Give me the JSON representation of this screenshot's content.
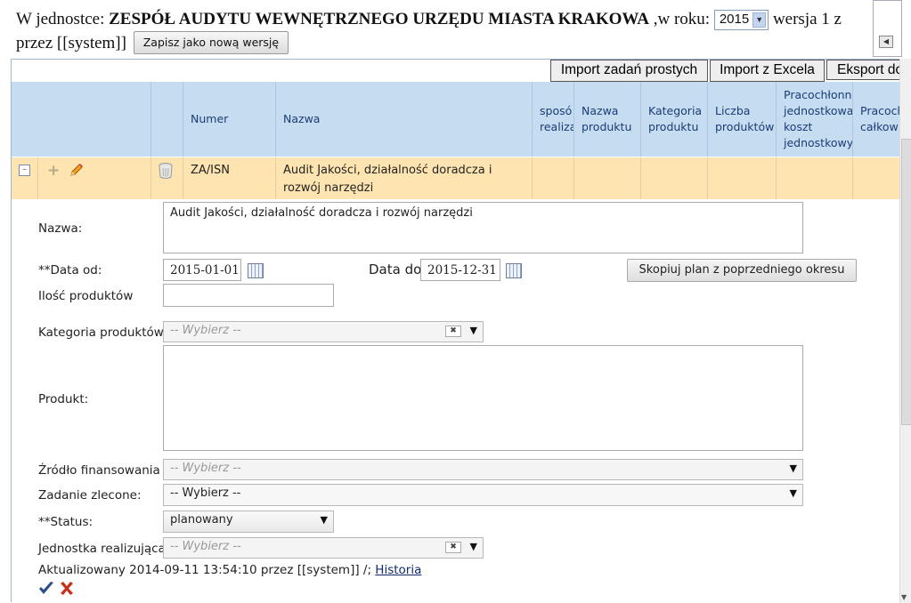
{
  "header": {
    "prefix": "W jednostce:",
    "unit_name": "ZESPÓŁ AUDYTU WEWNĘTRZNEGO URZĘDU MIASTA KRAKOWA",
    "year_label": ",w roku:",
    "year_value": "2015",
    "version_text": "wersja 1 z",
    "line2": "przez [[system]]",
    "save_version_button": "Zapisz jako nową wersję"
  },
  "toolbar": {
    "import_simple": "Import zadań prostych",
    "import_excel": "Import z Excela",
    "export": "Eksport do"
  },
  "table": {
    "columns": [
      "Numer",
      "Nazwa",
      "sposób realiza",
      "Nazwa produktu",
      "Kategoria produktu",
      "Liczba produktów",
      "Pracochłonn jednostkowa koszt jednostkowy",
      "Pracoch całkow"
    ],
    "column_lines": [
      [
        "Numer"
      ],
      [
        "Nazwa"
      ],
      [
        "sposó",
        "realiza"
      ],
      [
        "Nazwa",
        "produktu"
      ],
      [
        "Kategoria",
        "produktu"
      ],
      [
        "Liczba",
        "produktów"
      ],
      [
        "Pracochłonn",
        "jednostkowa",
        "koszt",
        "jednostkowy"
      ],
      [
        "Pracoch",
        "całkow"
      ]
    ],
    "row": {
      "numer": "ZA/ISN",
      "nazwa_line1": "Audit Jakości, działalność doradcza i",
      "nazwa_line2": "rozwój narzędzi"
    }
  },
  "form": {
    "nazwa_label": "Nazwa:",
    "nazwa_value": "Audit Jakości, działalność doradcza i rozwój narzędzi",
    "data_od_label": "**Data od:",
    "data_od_value": "2015-01-01",
    "data_do_label": "Data do:",
    "data_do_value": "2015-12-31",
    "copy_button": "Skopiuj plan z poprzedniego okresu",
    "ilosc_label": "Ilość produktów",
    "ilosc_value": "",
    "kategoria_label": "Kategoria produktów:",
    "kategoria_placeholder": "-- Wybierz --",
    "produkt_label": "Produkt:",
    "zrodlo_label": "Źródło finansowania",
    "zrodlo_placeholder": "-- Wybierz --",
    "zadanie_label": "Zadanie zlecone:",
    "zadanie_value": "-- Wybierz --",
    "status_label": "**Status:",
    "status_value": "planowany",
    "jednostka_label": "Jednostka realizująca:",
    "jednostka_placeholder": "-- Wybierz --",
    "updated_text": "Aktualizowany 2014-09-11 13:54:10 przez [[system]]  /;",
    "history_link": "Historia"
  }
}
